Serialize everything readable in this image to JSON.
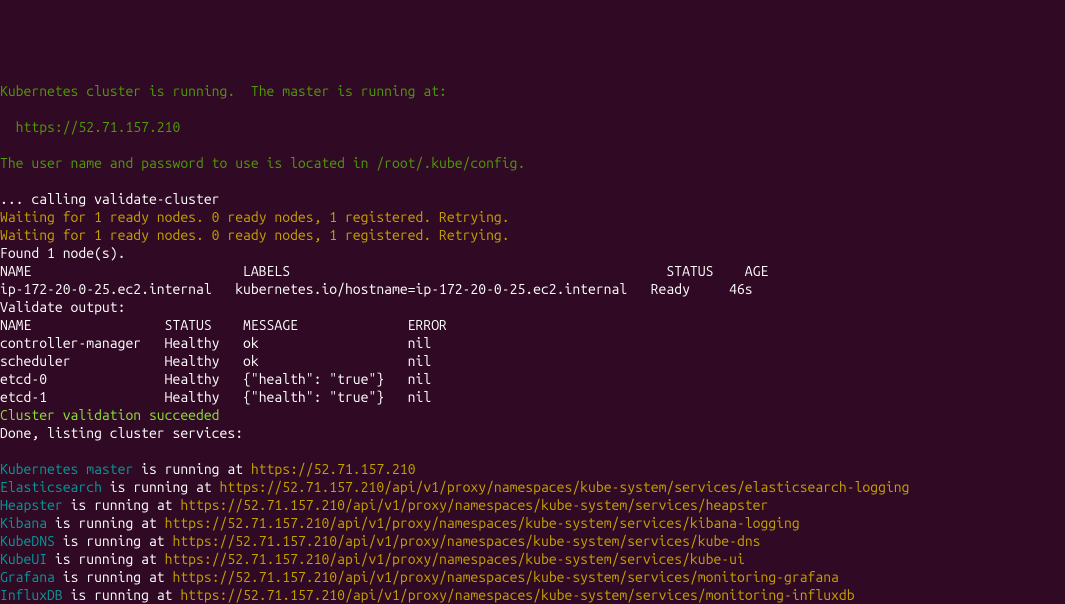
{
  "terminal": {
    "line1": "Kubernetes cluster is running.  The master is running at:",
    "line2": "  https://52.71.157.210",
    "line3": "The user name and password to use is located in /root/.kube/config.",
    "line4": "... calling validate-cluster",
    "line5": "Waiting for 1 ready nodes. 0 ready nodes, 1 registered. Retrying.",
    "line6": "Waiting for 1 ready nodes. 0 ready nodes, 1 registered. Retrying.",
    "line7": "Found 1 node(s).",
    "line8": "NAME                           LABELS                                                STATUS    AGE",
    "line9": "ip-172-20-0-25.ec2.internal   kubernetes.io/hostname=ip-172-20-0-25.ec2.internal   Ready     46s",
    "line10": "Validate output:",
    "line11": "NAME                 STATUS    MESSAGE              ERROR",
    "line12": "controller-manager   Healthy   ok                   nil",
    "line13": "scheduler            Healthy   ok                   nil",
    "line14": "etcd-0               Healthy   {\"health\": \"true\"}   nil",
    "line15": "etcd-1               Healthy   {\"health\": \"true\"}   nil",
    "line16": "Cluster validation succeeded",
    "line17": "Done, listing cluster services:",
    "services": {
      "master_label": "Kubernetes master",
      "master_running": " is running at ",
      "master_url": "https://52.71.157.210",
      "es_label": "Elasticsearch",
      "es_running": " is running at ",
      "es_url": "https://52.71.157.210/api/v1/proxy/namespaces/kube-system/services/elasticsearch-logging",
      "heapster_label": "Heapster",
      "heapster_running": " is running at ",
      "heapster_url": "https://52.71.157.210/api/v1/proxy/namespaces/kube-system/services/heapster",
      "kibana_label": "Kibana",
      "kibana_running": " is running at ",
      "kibana_url": "https://52.71.157.210/api/v1/proxy/namespaces/kube-system/services/kibana-logging",
      "kubedns_label": "KubeDNS",
      "kubedns_running": " is running at ",
      "kubedns_url": "https://52.71.157.210/api/v1/proxy/namespaces/kube-system/services/kube-dns",
      "kubeui_label": "KubeUI",
      "kubeui_running": " is running at ",
      "kubeui_url": "https://52.71.157.210/api/v1/proxy/namespaces/kube-system/services/kube-ui",
      "grafana_label": "Grafana",
      "grafana_running": " is running at ",
      "grafana_url": "https://52.71.157.210/api/v1/proxy/namespaces/kube-system/services/monitoring-grafana",
      "influxdb_label": "InfluxDB",
      "influxdb_running": " is running at ",
      "influxdb_url": "https://52.71.157.210/api/v1/proxy/namespaces/kube-system/services/monitoring-influxdb"
    }
  }
}
